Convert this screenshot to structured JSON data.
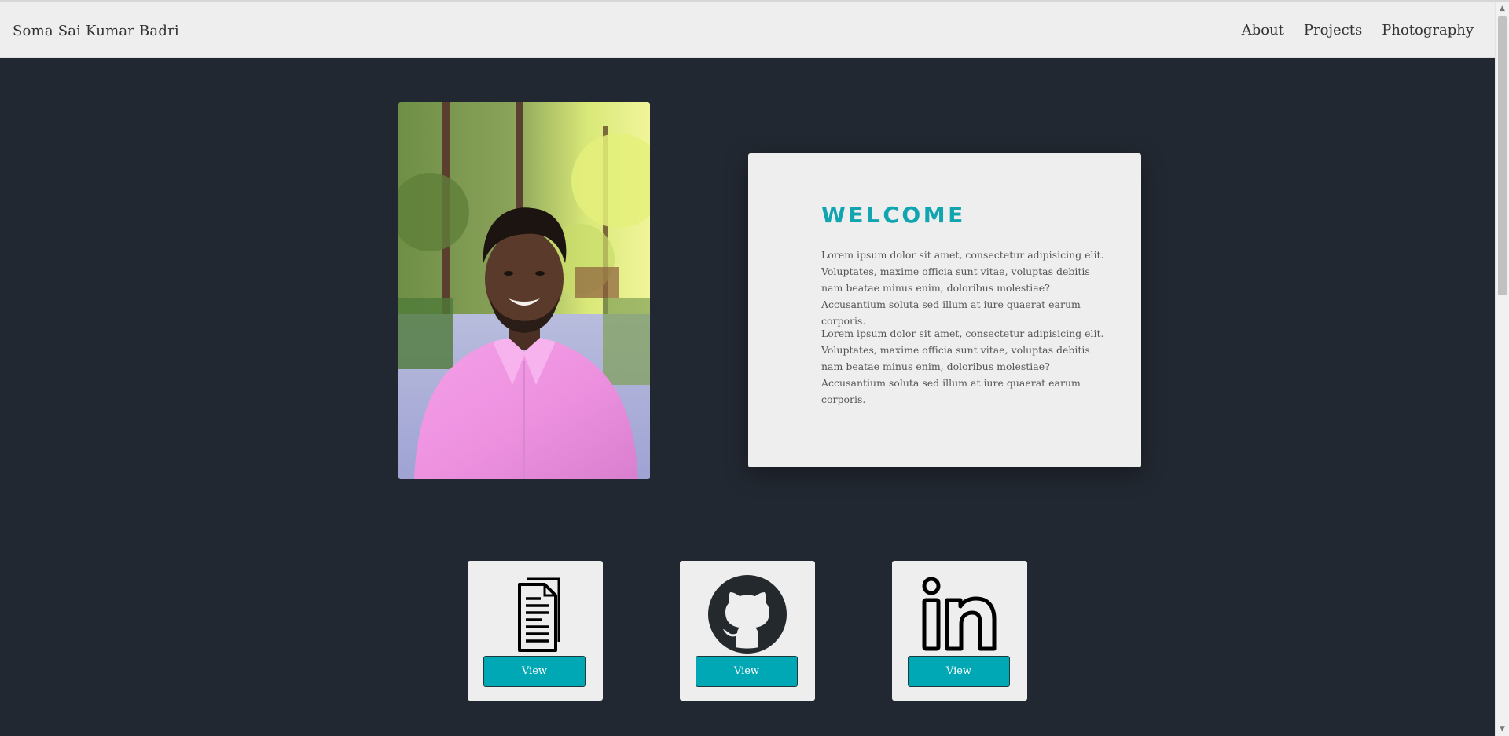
{
  "navbar": {
    "brand": "Soma Sai Kumar Badri",
    "links": [
      "About",
      "Projects",
      "Photography"
    ]
  },
  "welcome": {
    "title": "WELCOME",
    "paragraphs": [
      "Lorem ipsum dolor sit amet, consectetur adipisicing elit. Voluptates, maxime officia sunt vitae, voluptas debitis nam beatae minus enim, doloribus molestiae? Accusantium soluta sed illum at iure quaerat earum corporis.",
      "Lorem ipsum dolor sit amet, consectetur adipisicing elit. Voluptates, maxime officia sunt vitae, voluptas debitis nam beatae minus enim, doloribus molestiae? Accusantium soluta sed illum at iure quaerat earum corporis."
    ]
  },
  "links": [
    {
      "icon": "document-icon",
      "button_label": "View"
    },
    {
      "icon": "github-icon",
      "button_label": "View"
    },
    {
      "icon": "linkedin-icon",
      "button_label": "View"
    }
  ],
  "colors": {
    "background": "#222831",
    "navbar": "#eeeeee",
    "accent": "#11a5b2",
    "button": "#00a8b5",
    "card": "#eeeeee"
  }
}
